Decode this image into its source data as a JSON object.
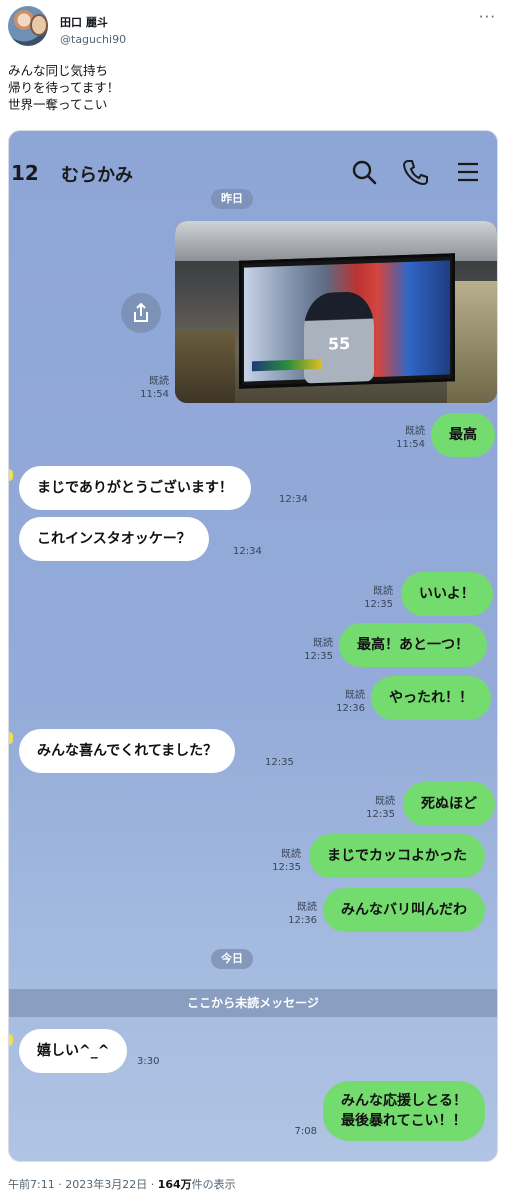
{
  "tweet": {
    "author_name": "田口 麗斗",
    "author_handle": "@taguchi90",
    "more_icon": "more-dots-icon",
    "text_lines": [
      "みんな同じ気持ち",
      "帰りを待ってます！",
      "世界一奪ってこい"
    ],
    "footer": {
      "time": "午前7:11",
      "date": "2023年3月22日",
      "separator": "·",
      "views_number": "164万",
      "views_suffix": "件の表示"
    }
  },
  "chat": {
    "unread_count": "12",
    "title": "むらかみ",
    "icons": [
      "search-icon",
      "phone-icon",
      "menu-icon"
    ],
    "date_top": "昨日",
    "date_today": "今日",
    "unread_divider": "ここから未読メッセージ",
    "photo": {
      "read": "既読",
      "time": "11:54",
      "jersey": "55"
    },
    "messages": [
      {
        "dir": "out",
        "text": "最高",
        "read": "既読",
        "time": "11:54"
      },
      {
        "dir": "in",
        "text": "まじでありがとうございます！",
        "time": "12:34"
      },
      {
        "dir": "in",
        "text": "これインスタオッケー？",
        "time": "12:34"
      },
      {
        "dir": "out",
        "text": "いいよ！",
        "read": "既読",
        "time": "12:35"
      },
      {
        "dir": "out",
        "text": "最高！あと一つ！",
        "read": "既読",
        "time": "12:35"
      },
      {
        "dir": "out",
        "text": "やったれ！！",
        "read": "既読",
        "time": "12:36"
      },
      {
        "dir": "in",
        "text": "みんな喜んでくれてました？",
        "time": "12:35"
      },
      {
        "dir": "out",
        "text": "死ぬほど",
        "read": "既読",
        "time": "12:35"
      },
      {
        "dir": "out",
        "text": "まじでカッコよかった",
        "read": "既読",
        "time": "12:35"
      },
      {
        "dir": "out",
        "text": "みんなバリ叫んだわ",
        "read": "既読",
        "time": "12:36"
      },
      {
        "dir": "in",
        "text": "嬉しい^_^",
        "time": "3:30"
      },
      {
        "dir": "out",
        "text_line1": "みんな応援しとる！",
        "text_line2": "最後暴れてこい！！",
        "time": "7:08"
      }
    ],
    "colors": {
      "outgoing_bubble": "#74db6f",
      "incoming_bubble": "#ffffff",
      "background": "#8ea6d6"
    }
  }
}
